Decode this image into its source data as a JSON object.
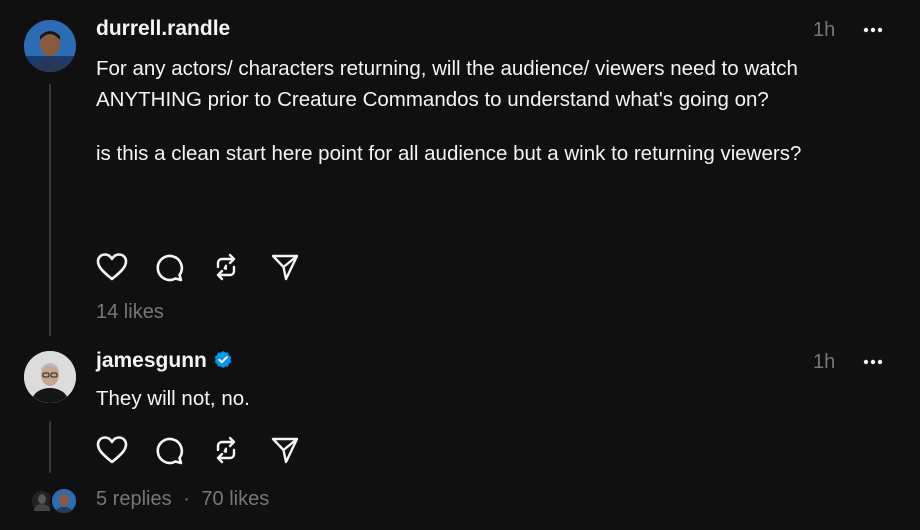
{
  "posts": [
    {
      "username": "durrell.randle",
      "time": "1h",
      "paragraphs": [
        "For any actors/ characters returning, will the audience/ viewers need to watch ANYTHING prior to Creature Commandos to understand what's going on?",
        "is this a clean start here point for all audience but a wink to returning viewers?"
      ],
      "likes": "14 likes"
    },
    {
      "username": "jamesgunn",
      "verified": true,
      "time": "1h",
      "paragraphs": [
        "They will not, no."
      ],
      "replies": "5 replies",
      "separator": "·",
      "likes": "70 likes"
    }
  ],
  "icons": {
    "like": "heart-icon",
    "comment": "speech-bubble-icon",
    "repost": "repost-icon",
    "share": "paper-plane-icon",
    "more": "ellipsis-icon",
    "verified": "verified-badge-icon"
  },
  "colors": {
    "background": "#101010",
    "text": "#f3f5f7",
    "secondary": "#777777",
    "verified": "#0095f6"
  }
}
